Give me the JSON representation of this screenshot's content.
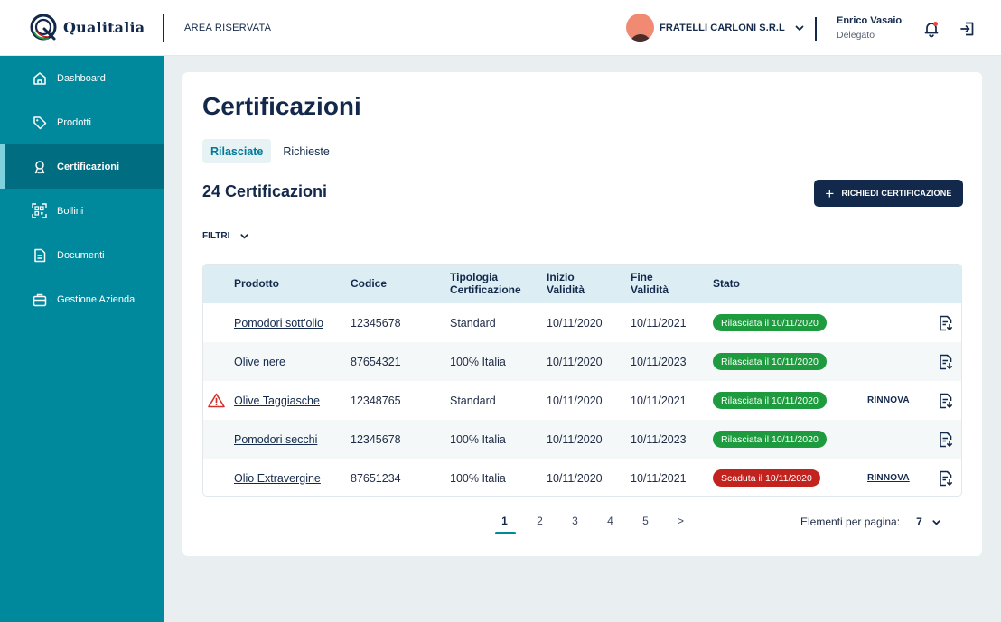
{
  "colors": {
    "brand_navy": "#13294b",
    "sidebar_teal": "#00899c",
    "sidebar_active": "#006d80",
    "badge_issued": "#1e9b3f",
    "badge_expired": "#c3231e",
    "warning": "#d0312d"
  },
  "header": {
    "logo_text": "Qualitalia",
    "area_label": "AREA RISERVATA",
    "company_name": "FRATELLI CARLONI S.R.L",
    "user_name": "Enrico Vasaio",
    "user_role": "Delegato",
    "icons": [
      "chevron-down-icon",
      "bell-icon",
      "logout-icon"
    ]
  },
  "sidebar": {
    "items": [
      {
        "label": "Dashboard",
        "icon": "home-icon",
        "active": false
      },
      {
        "label": "Prodotti",
        "icon": "tag-icon",
        "active": false
      },
      {
        "label": "Certificazioni",
        "icon": "award-icon",
        "active": true
      },
      {
        "label": "Bollini",
        "icon": "qr-code-icon",
        "active": false
      },
      {
        "label": "Documenti",
        "icon": "document-icon",
        "active": false
      },
      {
        "label": "Gestione Azienda",
        "icon": "briefcase-icon",
        "active": false
      }
    ]
  },
  "main": {
    "title": "Certificazioni",
    "tabs": [
      {
        "label": "Rilasciate",
        "active": true
      },
      {
        "label": "Richieste",
        "active": false
      }
    ],
    "count_title": "24 Certificazioni",
    "cta_label": "RICHIEDI CERTIFICAZIONE",
    "filters_label": "FILTRI"
  },
  "table": {
    "headers": {
      "product": "Prodotto",
      "code": "Codice",
      "type": "Tipologia Certificazione",
      "start": "Inizio Validità",
      "end": "Fine Validità",
      "status": "Stato"
    },
    "rows": [
      {
        "product": "Pomodori sott'olio",
        "code": "12345678",
        "type": "Standard",
        "start": "10/11/2020",
        "end": "10/11/2021",
        "status": "Rilasciata il 10/11/2020",
        "status_kind": "issued",
        "warning": false,
        "action": ""
      },
      {
        "product": "Olive nere",
        "code": "87654321",
        "type": "100% Italia",
        "start": "10/11/2020",
        "end": "10/11/2023",
        "status": "Rilasciata il 10/11/2020",
        "status_kind": "issued",
        "warning": false,
        "action": ""
      },
      {
        "product": "Olive Taggiasche",
        "code": "12348765",
        "type": "Standard",
        "start": "10/11/2020",
        "end": "10/11/2021",
        "status": "Rilasciata il 10/11/2020",
        "status_kind": "issued",
        "warning": true,
        "action": "RINNOVA"
      },
      {
        "product": "Pomodori secchi",
        "code": "12345678",
        "type": "100% Italia",
        "start": "10/11/2020",
        "end": "10/11/2023",
        "status": "Rilasciata il 10/11/2020",
        "status_kind": "issued",
        "warning": false,
        "action": ""
      },
      {
        "product": "Olio Extravergine",
        "code": "87651234",
        "type": "100% Italia",
        "start": "10/11/2020",
        "end": "10/11/2021",
        "status": "Scaduta il 10/11/2020",
        "status_kind": "expired",
        "warning": false,
        "action": "RINNOVA"
      }
    ]
  },
  "pagination": {
    "pages": [
      "1",
      "2",
      "3",
      "4",
      "5",
      ">"
    ],
    "current": "1",
    "per_page_label": "Elementi per pagina:",
    "per_page_value": "7"
  }
}
